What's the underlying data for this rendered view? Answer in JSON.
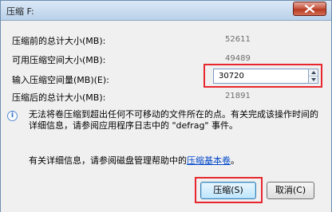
{
  "window": {
    "title": "压缩 F:"
  },
  "rows": [
    {
      "label": "压缩前的总计大小(MB):",
      "value": "52611"
    },
    {
      "label": "可用压缩空间大小(MB):",
      "value": "49489"
    },
    {
      "label": "输入压缩空间量(MB)(E):",
      "value": "30720"
    },
    {
      "label": "压缩后的总计大小(MB):",
      "value": "21891"
    }
  ],
  "info": {
    "text": "无法将卷压缩到超出任何不可移动的文件所在的点。有关完成该操作时间的详细信息，请参阅应用程序日志中的 \"defrag\" 事件。"
  },
  "help": {
    "prefix": "有关详细信息，请参阅磁盘管理帮助中的",
    "link": "压缩基本卷",
    "suffix": "。"
  },
  "buttons": {
    "shrink": "压缩(S)",
    "cancel": "取消(C)"
  },
  "icons": {
    "close": "close-icon",
    "info": "info-icon",
    "spin_up": "arrow-up-icon",
    "spin_down": "arrow-down-icon"
  },
  "colors": {
    "highlight": "#e8262d",
    "link": "#0046c8",
    "close_button": "#c75b46"
  }
}
